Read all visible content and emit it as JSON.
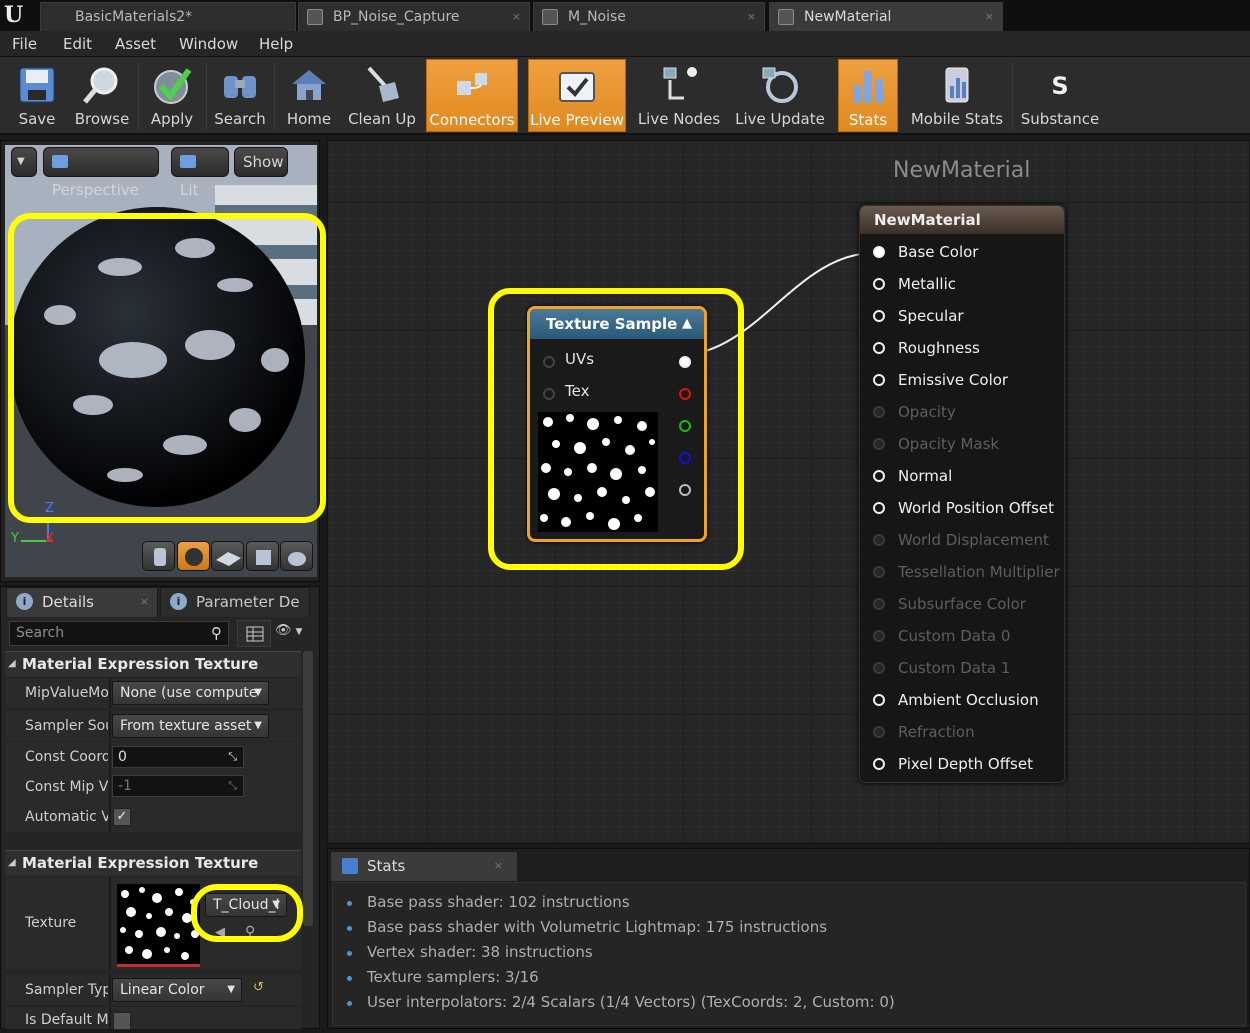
{
  "tabs": [
    {
      "label": "BasicMaterials2*"
    },
    {
      "label": "BP_Noise_Capture"
    },
    {
      "label": "M_Noise"
    },
    {
      "label": "NewMaterial"
    }
  ],
  "menu": [
    "File",
    "Edit",
    "Asset",
    "Window",
    "Help"
  ],
  "toolbar": [
    {
      "label": "Save",
      "icon": "save-icon"
    },
    {
      "label": "Browse",
      "icon": "browse-icon"
    },
    {
      "label": "Apply",
      "icon": "apply-icon"
    },
    {
      "label": "Search",
      "icon": "search-icon"
    },
    {
      "label": "Home",
      "icon": "home-icon"
    },
    {
      "label": "Clean Up",
      "icon": "cleanup-icon"
    },
    {
      "label": "Connectors",
      "icon": "connectors-icon",
      "active": true
    },
    {
      "label": "Live Preview",
      "icon": "live-preview-icon",
      "active": true
    },
    {
      "label": "Live Nodes",
      "icon": "live-nodes-icon"
    },
    {
      "label": "Live Update",
      "icon": "live-update-icon"
    },
    {
      "label": "Stats",
      "icon": "stats-icon",
      "active": true
    },
    {
      "label": "Mobile Stats",
      "icon": "mobile-stats-icon"
    },
    {
      "label": "Substance",
      "icon": "substance-icon"
    }
  ],
  "viewport": {
    "perspective_label": "Perspective",
    "lit_label": "Lit",
    "show_label": "Show",
    "axis_z": "Z",
    "axis_y": "Y",
    "axis_x": "X"
  },
  "details": {
    "tab_details": "Details",
    "tab_params": "Parameter De",
    "search_placeholder": "Search",
    "category1": "Material Expression Texture Sample",
    "props1": [
      {
        "name": "MipValueMo",
        "value": "None (use compute"
      },
      {
        "name": "Sampler Sou",
        "value": "From texture asset"
      },
      {
        "name": "Const Coordi",
        "value": "0"
      },
      {
        "name": "Const Mip Va",
        "value": "-1"
      },
      {
        "name": "Automatic V",
        "value": "✓"
      }
    ],
    "category2": "Material Expression Texture Base",
    "texture_label": "Texture",
    "texture_value": "T_Cloud_I",
    "sampler_type_label": "Sampler Typ",
    "sampler_type_value": "Linear Color",
    "is_default_label": "Is Default Mi"
  },
  "graph": {
    "title": "NewMaterial",
    "texture_node": {
      "title": "Texture Sample",
      "inputs": [
        "UVs",
        "Tex"
      ]
    },
    "material_node": {
      "title": "NewMaterial",
      "inputs": [
        {
          "label": "Base Color",
          "enabled": true,
          "connected": true
        },
        {
          "label": "Metallic",
          "enabled": true
        },
        {
          "label": "Specular",
          "enabled": true
        },
        {
          "label": "Roughness",
          "enabled": true
        },
        {
          "label": "Emissive Color",
          "enabled": true
        },
        {
          "label": "Opacity",
          "enabled": false
        },
        {
          "label": "Opacity Mask",
          "enabled": false
        },
        {
          "label": "Normal",
          "enabled": true
        },
        {
          "label": "World Position Offset",
          "enabled": true
        },
        {
          "label": "World Displacement",
          "enabled": false
        },
        {
          "label": "Tessellation Multiplier",
          "enabled": false
        },
        {
          "label": "Subsurface Color",
          "enabled": false
        },
        {
          "label": "Custom Data 0",
          "enabled": false
        },
        {
          "label": "Custom Data 1",
          "enabled": false
        },
        {
          "label": "Ambient Occlusion",
          "enabled": true
        },
        {
          "label": "Refraction",
          "enabled": false
        },
        {
          "label": "Pixel Depth Offset",
          "enabled": true
        }
      ]
    }
  },
  "stats": {
    "tab_label": "Stats",
    "lines": [
      "Base pass shader: 102 instructions",
      "Base pass shader with Volumetric Lightmap: 175 instructions",
      "Vertex shader: 38 instructions",
      "Texture samplers: 3/16",
      "User interpolators: 2/4 Scalars (1/4 Vectors) (TexCoords: 2, Custom: 0)"
    ]
  },
  "colors": {
    "accent": "#f0a030",
    "highlight": "#ffff00",
    "pin_red": "#e01010",
    "pin_green": "#10c010",
    "pin_blue": "#1010e0"
  }
}
